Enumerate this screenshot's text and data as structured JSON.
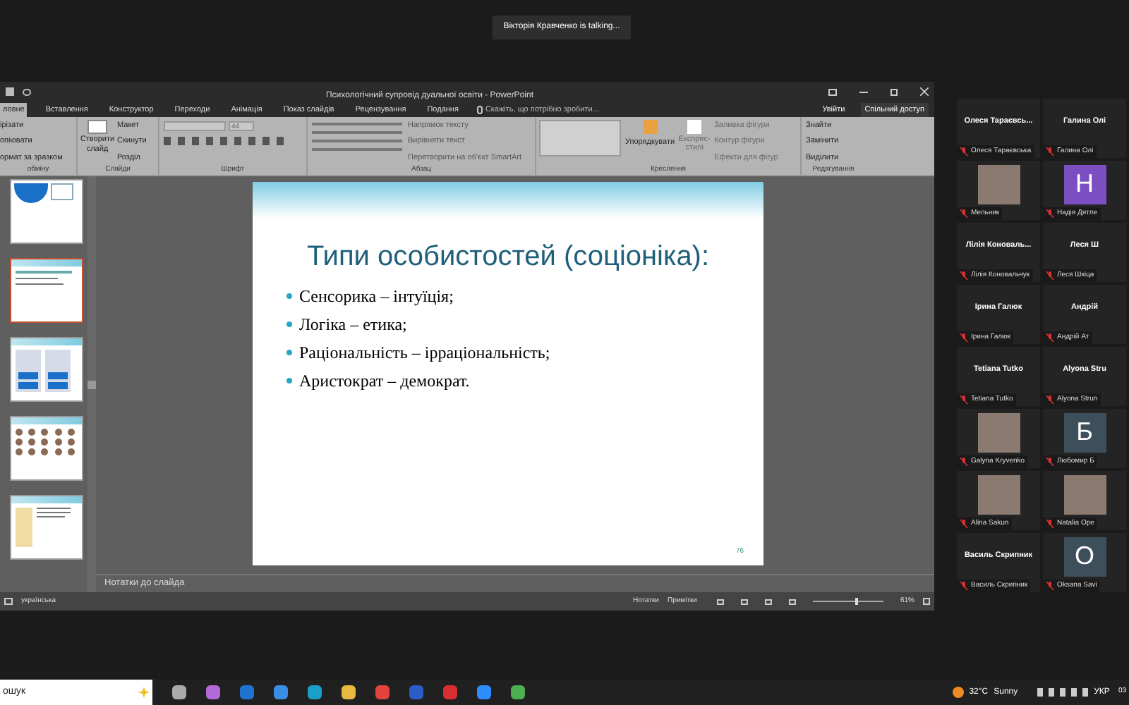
{
  "notification": "Вікторія Кравченко is talking...",
  "window": {
    "title": "Психологічний супровід дуальної освіти - PowerPoint"
  },
  "tabs": [
    {
      "label": "ловне",
      "selected": true
    },
    {
      "label": "Вставлення",
      "selected": false
    },
    {
      "label": "Конструктор",
      "selected": false
    },
    {
      "label": "Переходи",
      "selected": false
    },
    {
      "label": "Анімація",
      "selected": false
    },
    {
      "label": "Показ слайдів",
      "selected": false
    },
    {
      "label": "Рецензування",
      "selected": false
    },
    {
      "label": "Подання",
      "selected": false
    }
  ],
  "tell_me": "Скажіть, що потрібно зробити...",
  "sign_in": "Увійти",
  "share": "Спільний доступ",
  "ribbon": {
    "clipboard": {
      "items": [
        "ірізати",
        "опіювати",
        "ормат за зразком"
      ],
      "label": "обміну"
    },
    "slides": {
      "new_slide": "Створити слайд",
      "items": [
        "Макет",
        "Скинути",
        "Розділ"
      ],
      "label": "Слайди"
    },
    "font": {
      "size": "44",
      "label": "Шрифт"
    },
    "paragraph": {
      "items": [
        "Напрямок тексту",
        "Вирівняти текст",
        "Перетворити на об'єкт SmartArt"
      ],
      "label": "Абзац"
    },
    "drawing": {
      "arrange": "Упорядкувати",
      "styles": "Експрес-стилі",
      "items": [
        "Заливка фігури",
        "Контур фігури",
        "Ефекти для фігур"
      ],
      "label": "Креслення"
    },
    "editing": {
      "items": [
        "Знайти",
        "Замінити",
        "Виділити"
      ],
      "label": "Редагування"
    }
  },
  "thumbnails": [
    {
      "kind": "diagram",
      "selected": false
    },
    {
      "kind": "text",
      "selected": true
    },
    {
      "kind": "boxes",
      "selected": false
    },
    {
      "kind": "faces",
      "selected": false
    },
    {
      "kind": "note",
      "selected": false
    }
  ],
  "slide": {
    "title": "Типи особистостей (соціоніка):",
    "bullets": [
      "Сенсорика – інтуїція;",
      "Логіка – етика;",
      "Раціональність – ірраціональність;",
      "Аристократ – демократ."
    ],
    "number": "76"
  },
  "notes_placeholder": "Нотатки до слайда",
  "status_bar": {
    "language": "українська",
    "notes": "Нотатки",
    "comments": "Примітки",
    "zoom": {
      "level": 0.6
    },
    "zoom_percent": "61%"
  },
  "participants": [
    {
      "kind": "name",
      "name": "Олеся Тараєвсь...",
      "label": "Олеся Тараєвська"
    },
    {
      "kind": "name",
      "name": "Галина Олі",
      "label": "Галина Олі"
    },
    {
      "kind": "photo",
      "label": "Мельник"
    },
    {
      "kind": "letter",
      "name": "Н",
      "label": "Надія Дятле",
      "color": "#7b4fc2"
    },
    {
      "kind": "name",
      "name": "Лілія Коноваль...",
      "label": "Лілія Коновальчук"
    },
    {
      "kind": "name",
      "name": "Леся Ш",
      "label": "Леся Шкіца"
    },
    {
      "kind": "name",
      "name": "Ірина Галюк",
      "label": "Ірина Галюк"
    },
    {
      "kind": "name",
      "name": "Андрій",
      "label": "Андрій Ат"
    },
    {
      "kind": "name",
      "name": "Tetiana Tutko",
      "label": "Tetiana Tutko"
    },
    {
      "kind": "name",
      "name": "Alyona Stru",
      "label": "Alyona Strun"
    },
    {
      "kind": "photo",
      "label": "Galyna Kryvenko"
    },
    {
      "kind": "letter",
      "name": "Б",
      "label": "Любомир Б",
      "color": "#3e4f5c"
    },
    {
      "kind": "photo",
      "label": "Alina Sakun"
    },
    {
      "kind": "photo",
      "label": "Natalia Ope"
    },
    {
      "kind": "name",
      "name": "Василь Скрипник",
      "label": "Василь Скрипник"
    },
    {
      "kind": "letter",
      "name": "О",
      "label": "Oksana Savi",
      "color": "#3e4f5c"
    }
  ],
  "taskbar": {
    "search": "ошук",
    "temperature": "32°C",
    "weather": "Sunny",
    "language": "УКР",
    "clock": "03"
  }
}
